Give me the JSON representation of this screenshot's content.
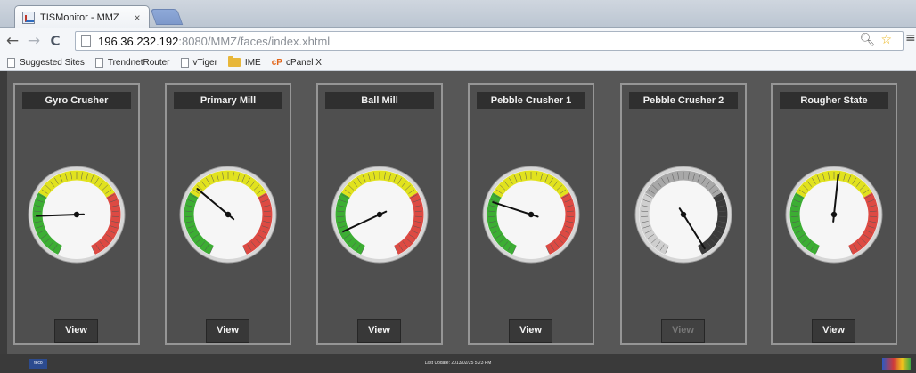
{
  "browser": {
    "tab_title": "TISMonitor - MMZ",
    "tab_close": "×",
    "url_host": "196.36.232.192",
    "url_rest": ":8080/MMZ/faces/index.xhtml",
    "bookmarks": [
      {
        "label": "Suggested Sites",
        "icon": "page-icon"
      },
      {
        "label": "TrendnetRouter",
        "icon": "page-icon"
      },
      {
        "label": "vTiger",
        "icon": "page-icon"
      },
      {
        "label": "IME",
        "icon": "folder-icon"
      },
      {
        "label": "cPanel X",
        "icon": "cpanel-icon",
        "prefix": "cP"
      }
    ]
  },
  "gauges": [
    {
      "title": "Gyro Crusher",
      "needle_angle": 268,
      "scheme": "color",
      "button": "View",
      "button_enabled": true
    },
    {
      "title": "Primary Mill",
      "needle_angle": 310,
      "scheme": "color",
      "button": "View",
      "button_enabled": true
    },
    {
      "title": "Ball Mill",
      "needle_angle": 245,
      "scheme": "color",
      "button": "View",
      "button_enabled": true
    },
    {
      "title": "Pebble Crusher 1",
      "needle_angle": 288,
      "scheme": "color",
      "button": "View",
      "button_enabled": true
    },
    {
      "title": "Pebble Crusher 2",
      "needle_angle": 148,
      "scheme": "mono",
      "button": "View",
      "button_enabled": false
    },
    {
      "title": "Rougher State",
      "needle_angle": 6,
      "scheme": "color",
      "button": "View",
      "button_enabled": true
    }
  ],
  "colors": {
    "zone_low": "#3cae33",
    "zone_mid": "#e1e21e",
    "zone_high": "#dd4a43",
    "mono_low": "#cfcfcf",
    "mono_mid": "#a8a8a8",
    "mono_high": "#3b3b3b"
  },
  "footer": {
    "status": "Last Update: 2013/02/25 5:23 PM",
    "logo_text": "teco"
  }
}
